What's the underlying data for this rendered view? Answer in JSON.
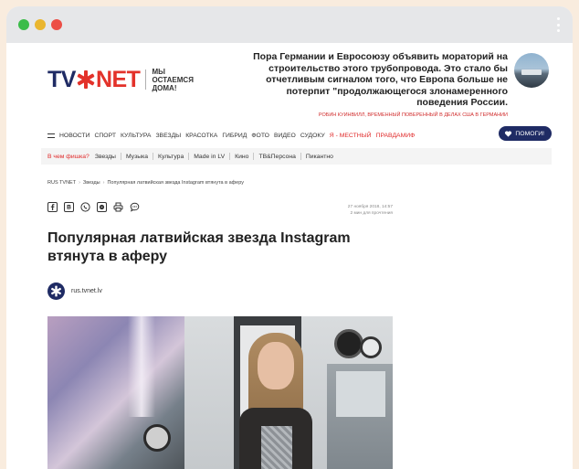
{
  "site": {
    "logo_tv": "TV",
    "logo_x": "✱",
    "logo_net": "NET",
    "slogan": "МЫ ОСТАЕМСЯ ДОМА!"
  },
  "promo": {
    "text": "Пора Германии и Евросоюзу объявить мораторий на строительство этого трубопровода. Это стало бы отчетливым сигналом того, что Европа больше не потерпит \"продолжающегося злонамеренного поведения России.",
    "caption": "РОБИН КУИНВИЛЛ, ВРЕМЕННЫЙ ПОВЕРЕННЫЙ В ДЕЛАХ США В ГЕРМАНИИ"
  },
  "nav": {
    "items": [
      "НОВОСТИ",
      "СПОРТ",
      "КУЛЬТУРА",
      "ЗВЕЗДЫ",
      "КРАСОТКА",
      "ГИБРИД",
      "ФОТО",
      "ВИДЕО",
      "СУДОКУ"
    ],
    "red_items": [
      "Я - МЕСТНЫЙ",
      "ПРАВДАМИФ"
    ],
    "help_button": "ПОМОГИ!"
  },
  "subnav": {
    "highlight": "В чем фишка?",
    "items": [
      "Звезды",
      "Музыка",
      "Культура",
      "Made in LV",
      "Кино",
      "TB&Персона",
      "Пикантно"
    ]
  },
  "breadcrumbs": [
    "RUS TVNET",
    "Звезды",
    "Популярная латвийская звезда Instagram втянута в аферу"
  ],
  "share_icons": [
    "facebook-icon",
    "vk-icon",
    "whatsapp-icon",
    "messenger-icon",
    "print-icon",
    "comments-icon"
  ],
  "article": {
    "date": "27 ноября 2018, 14:57",
    "read_time": "2 мин для прочтения",
    "headline": "Популярная латвийская звезда Instagram втянута в аферу",
    "author": "rus.tvnet.lv"
  },
  "colors": {
    "brand_navy": "#1f2b64",
    "brand_red": "#e3322a",
    "page_bg": "#f9ecde"
  }
}
